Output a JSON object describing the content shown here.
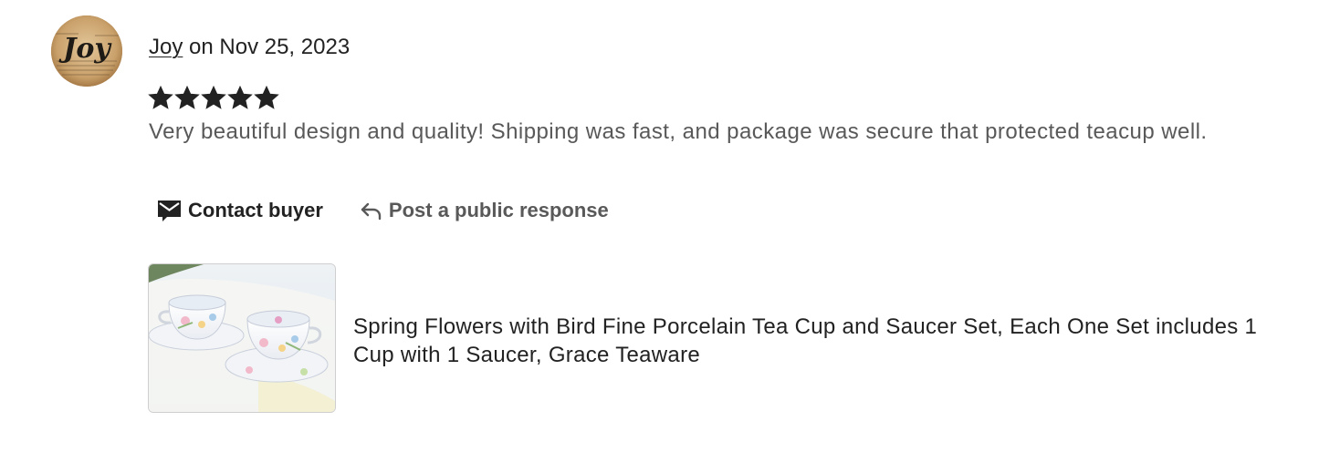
{
  "review": {
    "avatar_icon": "reviewer-avatar",
    "avatar_text": "Joy",
    "reviewer_name": "Joy",
    "date_text": " on Nov 25, 2023",
    "rating": 5,
    "rating_max": 5,
    "star_color": "#222222",
    "text": "Very beautiful design and quality! Shipping was fast, and package was secure that protected teacup well."
  },
  "actions": {
    "contact_label": "Contact buyer",
    "contact_icon": "envelope-icon",
    "respond_label": "Post a public response",
    "respond_icon": "reply-arrow-icon"
  },
  "product": {
    "thumbnail_icon": "teacup-set-photo",
    "title": "Spring Flowers with Bird Fine Porcelain Tea Cup and Saucer Set, Each One Set includes 1 Cup with 1 Saucer, Grace Teaware"
  }
}
